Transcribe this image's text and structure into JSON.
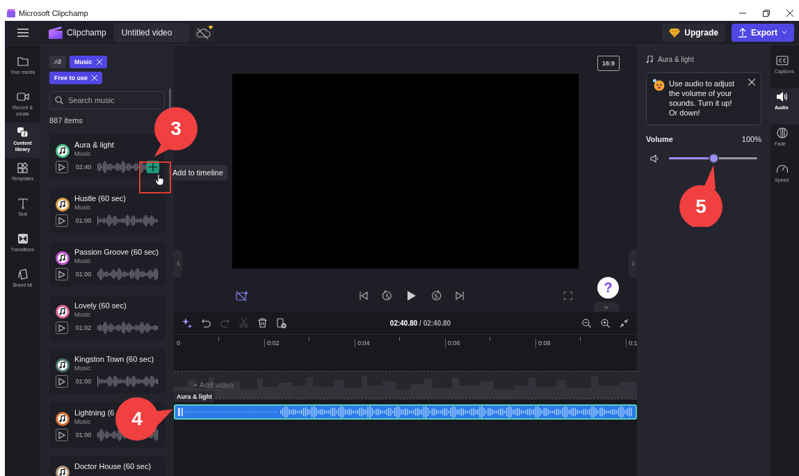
{
  "window": {
    "title": "Microsoft Clipchamp"
  },
  "header": {
    "logo": "Clipchamp",
    "project_title": "Untitled video",
    "upgrade": "Upgrade",
    "export": "Export"
  },
  "nav": [
    {
      "label": "Your media",
      "selected": false
    },
    {
      "label": "Record & create",
      "selected": false
    },
    {
      "label": "Content library",
      "selected": true
    },
    {
      "label": "Templates",
      "selected": false
    },
    {
      "label": "Text",
      "selected": false
    },
    {
      "label": "Transitions",
      "selected": false
    },
    {
      "label": "Brand kit",
      "selected": false
    }
  ],
  "library": {
    "filters": [
      {
        "label": "All",
        "selected": false
      },
      {
        "label": "Music",
        "selected": true
      },
      {
        "label": "Free to use",
        "selected": true
      }
    ],
    "search": {
      "placeholder": "Search music"
    },
    "count": "887 items",
    "tracks": [
      {
        "title": "Aura & light",
        "type": "Music",
        "duration": "02:40",
        "hovered": true
      },
      {
        "title": "Hustle (60 sec)",
        "type": "Music",
        "duration": "01:00",
        "hovered": false
      },
      {
        "title": "Passion Groove (60 sec)",
        "type": "Music",
        "duration": "01:00",
        "hovered": false
      },
      {
        "title": "Lovely (60 sec)",
        "type": "Music",
        "duration": "01:02",
        "hovered": false
      },
      {
        "title": "Kingston Town (60 sec)",
        "type": "Music",
        "duration": "01:00",
        "hovered": false
      },
      {
        "title": "Lightning (6",
        "type": "Music",
        "duration": "01:00",
        "hovered": false
      },
      {
        "title": "Doctor House (60 sec)"
      }
    ],
    "tooltip": "Add to timeline"
  },
  "preview": {
    "aspect": "16:9",
    "help": "?"
  },
  "timeline": {
    "current": "02:40.80",
    "total": "/ 02:40.80",
    "ruler": [
      "0",
      "0:02",
      "0:04",
      "0:06",
      "0:08",
      "0:1"
    ],
    "add_video": "+ Add video",
    "clip_label": "Aura & light"
  },
  "properties": {
    "title": "Aura & light",
    "tip": "Use audio to adjust the volume of your sounds. Turn it up! Or down!",
    "volume_label": "Volume",
    "volume_reading": "100%",
    "level": 0.5
  },
  "side_tabs": [
    {
      "label": "Captions",
      "selected": false
    },
    {
      "label": "Audio",
      "selected": true
    },
    {
      "label": "Fade",
      "selected": false
    },
    {
      "label": "Speed",
      "selected": false
    }
  ],
  "callouts": [
    {
      "number": "3"
    },
    {
      "number": "4"
    },
    {
      "number": "5"
    }
  ]
}
